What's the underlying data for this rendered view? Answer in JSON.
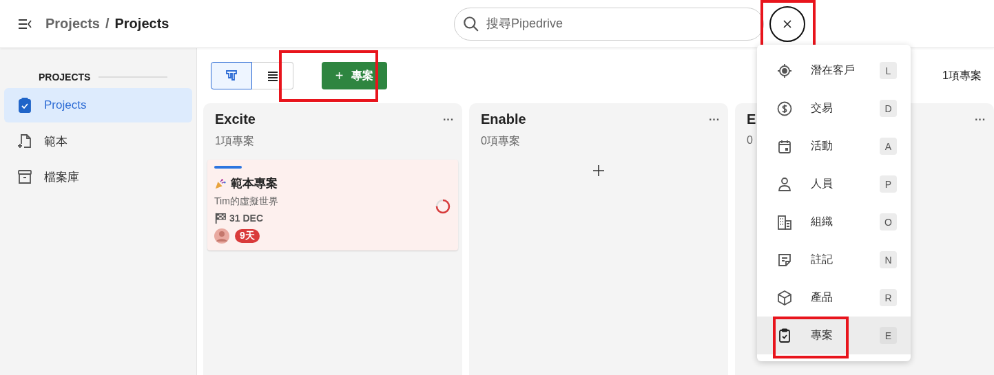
{
  "breadcrumb": [
    {
      "label": "Projects",
      "current": false
    },
    {
      "label": "/",
      "current": false
    },
    {
      "label": "Projects",
      "current": true
    }
  ],
  "search": {
    "placeholder": "搜尋Pipedrive"
  },
  "close_button": {
    "highlighted": true
  },
  "sidebar": {
    "heading": "PROJECTS",
    "items": [
      {
        "label": "Projects",
        "selected": true
      },
      {
        "label": "範本",
        "selected": false
      },
      {
        "label": "檔案庫",
        "selected": false
      }
    ]
  },
  "toolbar": {
    "views": [
      {
        "selected": true
      },
      {
        "selected": false
      }
    ],
    "add_button": {
      "icon": "+",
      "label": "專案",
      "highlighted": true
    },
    "count": "1項專案"
  },
  "columns": [
    {
      "title": "Excite",
      "count": "1項專案",
      "menu": "···",
      "cards": [
        {
          "title": "範本專案",
          "subtitle": "Tim的虛擬世界",
          "date": "31 DEC",
          "badge": "9天"
        }
      ]
    },
    {
      "title": "Enable",
      "count": "0項專案",
      "menu": "···",
      "add": true
    },
    {
      "title": "E",
      "count": "0",
      "menu": "···"
    }
  ],
  "quick_add_menu": {
    "items": [
      {
        "label": "潛在客戶",
        "key": "L",
        "selected": false,
        "highlighted": false
      },
      {
        "label": "交易",
        "key": "D",
        "selected": false,
        "highlighted": false
      },
      {
        "label": "活動",
        "key": "A",
        "selected": false,
        "highlighted": false
      },
      {
        "label": "人員",
        "key": "P",
        "selected": false,
        "highlighted": false
      },
      {
        "label": "組織",
        "key": "O",
        "selected": false,
        "highlighted": false
      },
      {
        "label": "註記",
        "key": "N",
        "selected": false,
        "highlighted": false
      },
      {
        "label": "產品",
        "key": "R",
        "selected": false,
        "highlighted": false
      },
      {
        "label": "專案",
        "key": "E",
        "selected": true,
        "highlighted": true
      }
    ]
  }
}
